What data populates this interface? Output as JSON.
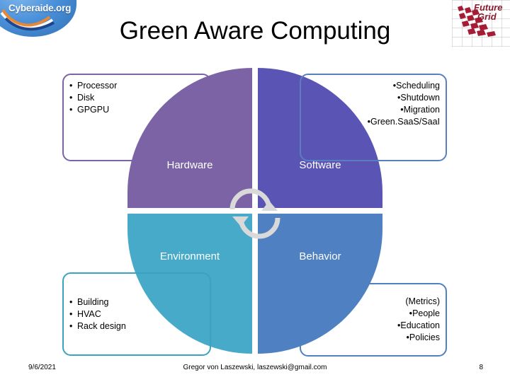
{
  "slide": {
    "title": "Green Aware Computing",
    "logos": {
      "left": {
        "name": "cyberaide-logo",
        "text": "Cyberaide.org"
      },
      "right": {
        "name": "futuregrid-logo",
        "line1": "Future",
        "line2": "Grid"
      }
    },
    "diagram": {
      "quadrants": [
        {
          "key": "hardware",
          "label": "Hardware",
          "color": "#7c63a5"
        },
        {
          "key": "software",
          "label": "Software",
          "color": "#5a54b4"
        },
        {
          "key": "environment",
          "label": "Environment",
          "color": "#46aac8"
        },
        {
          "key": "behavior",
          "label": "Behavior",
          "color": "#4e80c2"
        }
      ],
      "center_icon": "cycle-arrows-icon",
      "center_icon_color": "#d9d9d9"
    },
    "callouts": {
      "hardware": {
        "border_color": "#7c63a5",
        "items": [
          "Processor",
          "Disk",
          "GPGPU"
        ]
      },
      "software": {
        "border_color": "#5a7fbf",
        "items": [
          "Scheduling",
          "Shutdown",
          "Migration",
          "Green.SaaS/SaaI"
        ]
      },
      "environment": {
        "border_color": "#3ba2bf",
        "items": [
          "Building",
          "HVAC",
          "Rack design"
        ]
      },
      "behavior": {
        "border_color": "#4e80c2",
        "heading": "(Metrics)",
        "items": [
          "People",
          "Education",
          "Policies"
        ]
      }
    },
    "footer": {
      "date": "9/6/2021",
      "center": "Gregor von Laszewski, laszewski@gmail.com",
      "page": "8"
    },
    "bullet_glyph": "•"
  }
}
